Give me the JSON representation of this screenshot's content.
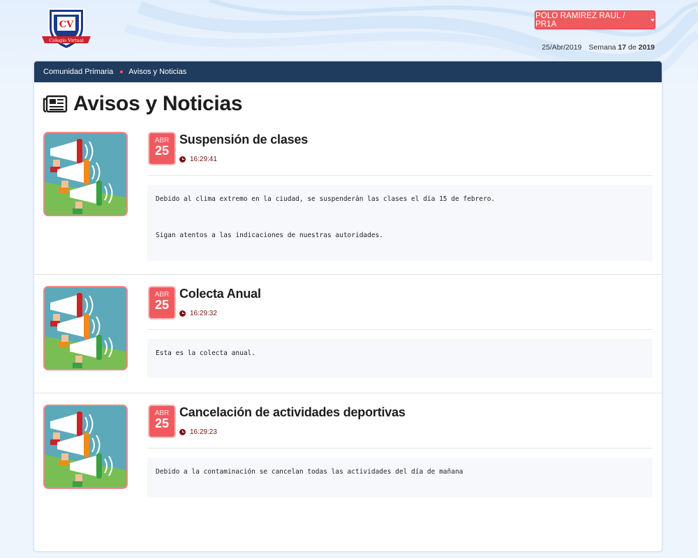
{
  "logo": {
    "initials": "CV",
    "ribbon": "Colegio Virtual"
  },
  "user": {
    "label": "POLO RAMIREZ RAUL / PR1A"
  },
  "date_info": {
    "date": "25/Abr/2019",
    "week_label": "Semana",
    "week_number": "17",
    "of_label": "de",
    "year": "2019"
  },
  "breadcrumb": {
    "items": [
      "Comunidad Primaria",
      "Avisos y Noticias"
    ]
  },
  "page": {
    "title": "Avisos y Noticias",
    "icon": "newspaper-icon"
  },
  "news": [
    {
      "month": "ABR",
      "day": "25",
      "title": "Suspensión de clases",
      "time": "16:29:41",
      "body": [
        "Debido al clima extremo en la ciudad, se suspenderán las clases el día 15 de febrero.",
        "Sigan atentos a las indicaciones de nuestras autoridades."
      ]
    },
    {
      "month": "ABR",
      "day": "25",
      "title": "Colecta Anual",
      "time": "16:29:32",
      "body": [
        "Esta es la colecta anual."
      ]
    },
    {
      "month": "ABR",
      "day": "25",
      "title": "Cancelación de actividades deportivas",
      "time": "16:29:23",
      "body": [
        "Debido a la contaminación se cancelan todas las actividades del día de mañana"
      ]
    }
  ],
  "colors": {
    "accent": "#ef5a5f",
    "navbar": "#1f3b5e",
    "clock": "#7a1010"
  }
}
